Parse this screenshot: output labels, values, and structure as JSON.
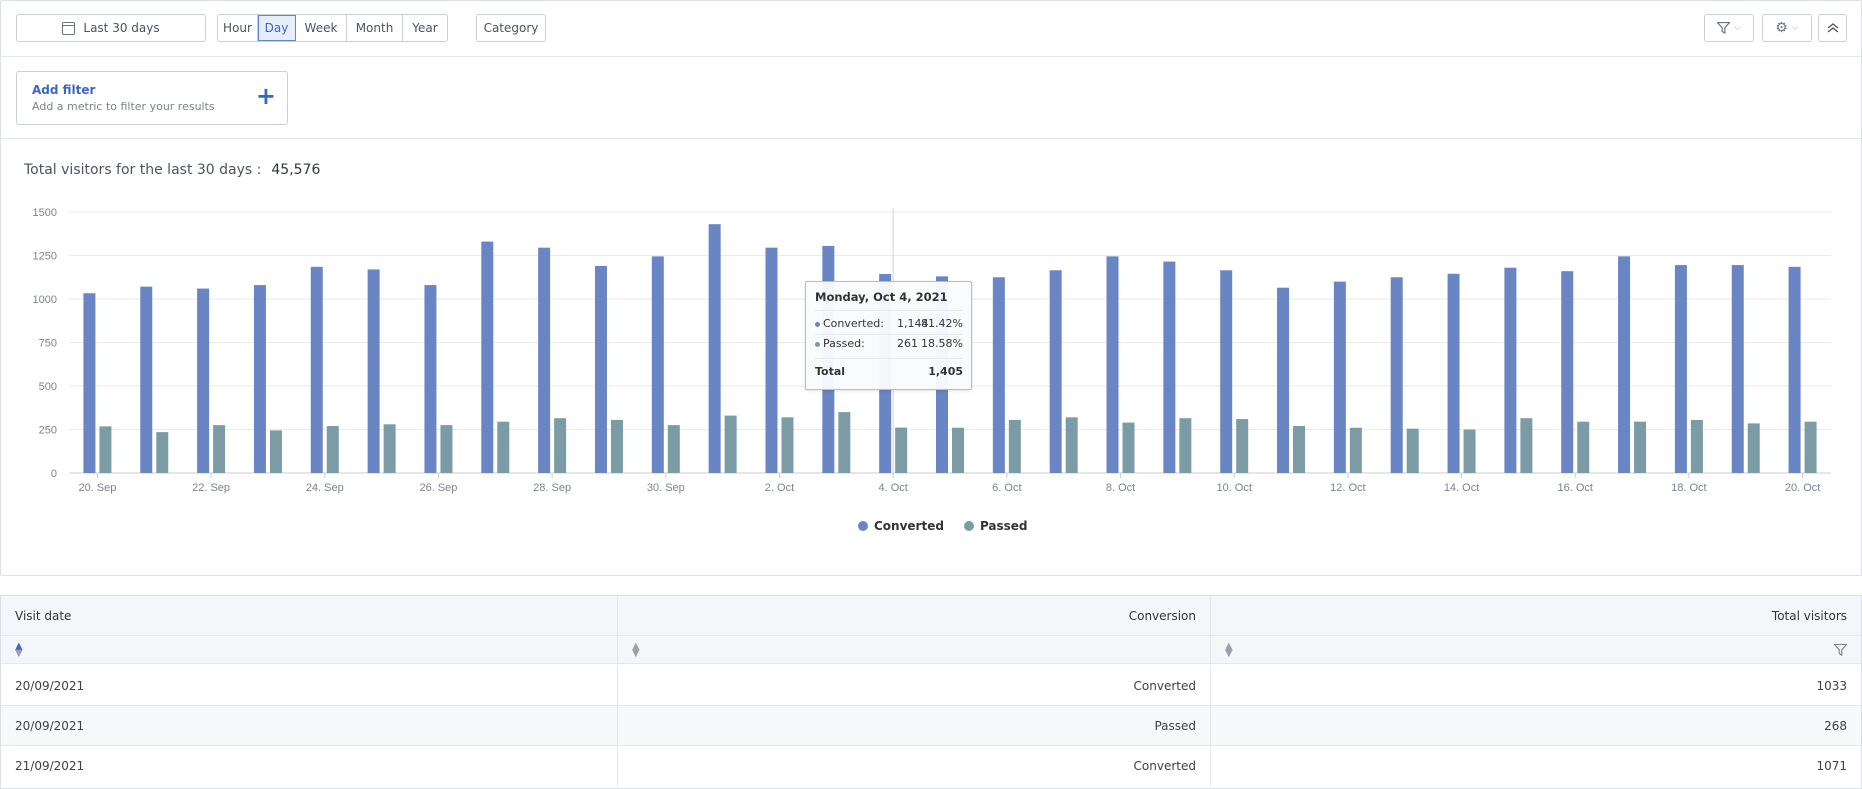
{
  "toolbar": {
    "date_range": "Last 30 days",
    "granularity": [
      "Hour",
      "Day",
      "Week",
      "Month",
      "Year"
    ],
    "selected_granularity": "Day",
    "category_label": "Category",
    "icons": [
      "calendar-icon",
      "filter-icon",
      "gear-icon",
      "collapse-up-icon"
    ]
  },
  "add_filter": {
    "title": "Add filter",
    "subtitle": "Add a metric to filter your results",
    "plus": "+"
  },
  "summary": {
    "label": "Total visitors for the last 30 days :",
    "value": "45,576"
  },
  "chart_data": {
    "type": "bar",
    "categories": [
      "20. Sep",
      "21. Sep",
      "22. Sep",
      "23. Sep",
      "24. Sep",
      "25. Sep",
      "26. Sep",
      "27. Sep",
      "28. Sep",
      "29. Sep",
      "30. Sep",
      "1. Oct",
      "2. Oct",
      "3. Oct",
      "4. Oct",
      "5. Oct",
      "6. Oct",
      "7. Oct",
      "8. Oct",
      "9. Oct",
      "10. Oct",
      "11. Oct",
      "12. Oct",
      "13. Oct",
      "14. Oct",
      "15. Oct",
      "16. Oct",
      "17. Oct",
      "18. Oct",
      "19. Oct",
      "20. Oct"
    ],
    "x_tick_labels": [
      "20. Sep",
      "22. Sep",
      "24. Sep",
      "26. Sep",
      "28. Sep",
      "30. Sep",
      "2. Oct",
      "4. Oct",
      "6. Oct",
      "8. Oct",
      "10. Oct",
      "12. Oct",
      "14. Oct",
      "16. Oct",
      "18. Oct",
      "20. Oct"
    ],
    "series": [
      {
        "name": "Converted",
        "color": "#6a85c4",
        "values": [
          1033,
          1071,
          1060,
          1080,
          1185,
          1170,
          1080,
          1330,
          1295,
          1190,
          1245,
          1430,
          1295,
          1305,
          1144,
          1130,
          1125,
          1165,
          1245,
          1215,
          1165,
          1065,
          1100,
          1125,
          1145,
          1180,
          1160,
          1245,
          1195,
          1195,
          1185
        ]
      },
      {
        "name": "Passed",
        "color": "#7b9ca5",
        "values": [
          268,
          235,
          275,
          245,
          270,
          280,
          275,
          295,
          315,
          305,
          275,
          330,
          320,
          350,
          261,
          260,
          305,
          320,
          290,
          315,
          310,
          270,
          260,
          255,
          250,
          315,
          295,
          295,
          305,
          285,
          295
        ]
      }
    ],
    "ylim": [
      0,
      1500
    ],
    "y_ticks": [
      0,
      250,
      500,
      750,
      1000,
      1250,
      1500
    ],
    "grid": true,
    "legend": "bottom-center",
    "tooltip": {
      "title": "Monday, Oct 4, 2021",
      "rows": [
        {
          "label": "Converted:",
          "value": "1,144",
          "pct": "81.42%"
        },
        {
          "label": "Passed:",
          "value": "261",
          "pct": "18.58%"
        }
      ],
      "total_label": "Total",
      "total_value": "1,405"
    }
  },
  "table": {
    "headers": [
      "Visit date",
      "Conversion",
      "Total visitors"
    ],
    "rows": [
      [
        "20/09/2021",
        "Converted",
        "1033"
      ],
      [
        "20/09/2021",
        "Passed",
        "268"
      ],
      [
        "21/09/2021",
        "Converted",
        "1071"
      ]
    ]
  }
}
